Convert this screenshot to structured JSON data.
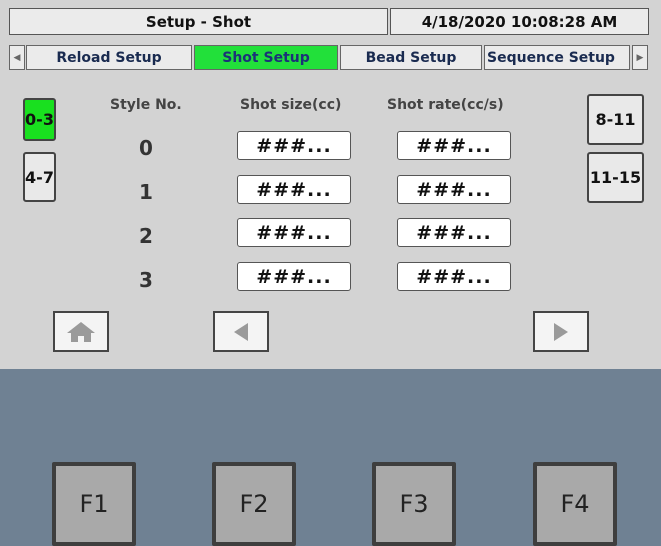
{
  "header": {
    "title": "Setup - Shot",
    "datetime": "4/18/2020 10:08:28 AM"
  },
  "tabs": [
    {
      "label": "Reload Setup",
      "active": false
    },
    {
      "label": "Shot Setup",
      "active": true
    },
    {
      "label": "Bead Setup",
      "active": false
    },
    {
      "label": "Sequence Setup",
      "active": false
    }
  ],
  "range_buttons": {
    "left": [
      {
        "label": "0-3",
        "active": true
      },
      {
        "label": "4-7",
        "active": false
      }
    ],
    "right": [
      {
        "label": "8-11",
        "active": false
      },
      {
        "label": "11-15",
        "active": false
      }
    ]
  },
  "columns": {
    "style_no": "Style No.",
    "shot_size": "Shot size(cc)",
    "shot_rate": "Shot rate(cc/s)"
  },
  "rows": [
    {
      "style_no": "0",
      "shot_size": "###...",
      "shot_rate": "###..."
    },
    {
      "style_no": "1",
      "shot_size": "###...",
      "shot_rate": "###..."
    },
    {
      "style_no": "2",
      "shot_size": "###...",
      "shot_rate": "###..."
    },
    {
      "style_no": "3",
      "shot_size": "###...",
      "shot_rate": "###..."
    }
  ],
  "nav": {
    "home_icon": "home-icon",
    "back_icon": "triangle-left-icon",
    "forward_icon": "triangle-right-icon"
  },
  "function_keys": [
    "F1",
    "F2",
    "F3",
    "F4"
  ],
  "colors": {
    "active_tab": "#22e03a",
    "active_range": "#19e01f",
    "panel_bg": "#d3d3d3",
    "bezel": "#6f8193"
  }
}
